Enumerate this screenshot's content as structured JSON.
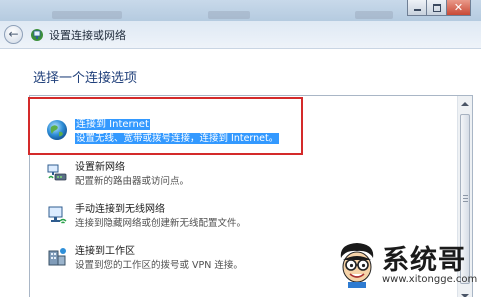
{
  "window": {
    "title": "设置连接或网络",
    "controls": {
      "minimize": "minimize",
      "maximize": "maximize",
      "close": "close"
    }
  },
  "main": {
    "prompt": "选择一个连接选项",
    "options": [
      {
        "title": "连接到 Internet",
        "desc": "设置无线、宽带或拨号连接，连接到 Internet。",
        "icon": "globe-icon",
        "selected": true
      },
      {
        "title": "设置新网络",
        "desc": "配置新的路由器或访问点。",
        "icon": "network-setup-icon",
        "selected": false
      },
      {
        "title": "手动连接到无线网络",
        "desc": "连接到隐藏网络或创建新无线配置文件。",
        "icon": "wireless-network-icon",
        "selected": false
      },
      {
        "title": "连接到工作区",
        "desc": "设置到您的工作区的拨号或 VPN 连接。",
        "icon": "workplace-icon",
        "selected": false
      }
    ]
  },
  "watermark": {
    "text": "系统哥",
    "url": "www.xitongge.com"
  },
  "colors": {
    "selection": "#3399ff",
    "annotation_box": "#d42a2a",
    "prompt_text": "#1f3f7a"
  }
}
